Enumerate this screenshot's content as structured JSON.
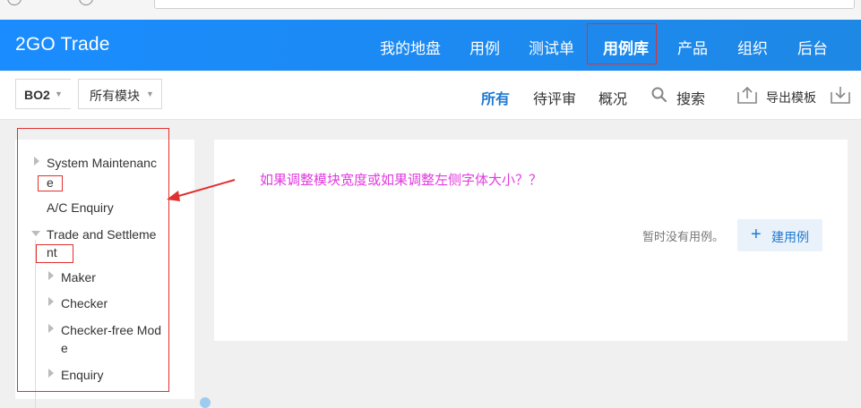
{
  "header": {
    "brand": "2GO Trade",
    "nav": [
      {
        "label": "我的地盘",
        "active": false
      },
      {
        "label": "用例",
        "active": false
      },
      {
        "label": "测试单",
        "active": false
      },
      {
        "label": "用例库",
        "active": true
      },
      {
        "label": "产品",
        "active": false
      },
      {
        "label": "组织",
        "active": false
      },
      {
        "label": "后台",
        "active": false
      }
    ]
  },
  "toolbar": {
    "library": "BO2",
    "module": "所有模块",
    "filters": [
      {
        "label": "所有",
        "active": true
      },
      {
        "label": "待评审",
        "active": false
      },
      {
        "label": "概况",
        "active": false
      }
    ],
    "search": "搜索",
    "export": "导出模板"
  },
  "tree": [
    {
      "text": "System Maintenanc",
      "wrap": "e",
      "expanded": false
    },
    {
      "text": "A/C Enquiry"
    },
    {
      "text": "Trade and Settleme",
      "wrap": "nt",
      "expanded": true
    },
    {
      "text": "Maker"
    },
    {
      "text": "Checker"
    },
    {
      "text": "Checker-free Mod",
      "wrap": "e"
    },
    {
      "text": "Enquiry"
    }
  ],
  "main": {
    "annotation": "如果调整模块宽度或如果调整左侧字体大小？？",
    "empty_text": "暂时没有用例。",
    "new_case_button": "建用例"
  },
  "colors": {
    "nav_bg": "#1a8cff",
    "accent": "#1f7ad1",
    "annotation": "#e23be0",
    "highlight_box": "#e0302f"
  }
}
